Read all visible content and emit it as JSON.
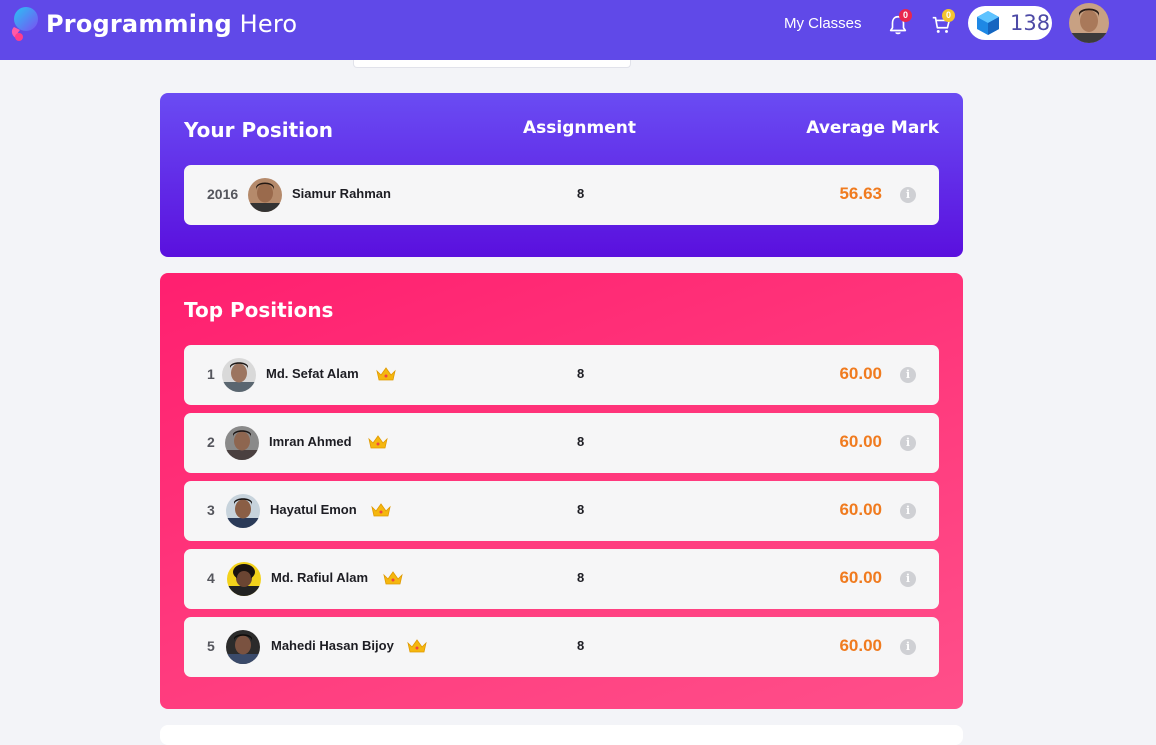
{
  "header": {
    "brand_part1": "Programming",
    "brand_part2": " Hero",
    "nav_my_classes": "My Classes",
    "notifications_count": "0",
    "cart_count": "0",
    "gems": "138"
  },
  "your_position": {
    "title": "Your Position",
    "col_assignment": "Assignment",
    "col_average_mark": "Average Mark",
    "row": {
      "rank": "2016",
      "name": "Siamur Rahman",
      "assignment": "8",
      "mark": "56.63"
    }
  },
  "top_positions": {
    "title": "Top Positions",
    "rows": [
      {
        "rank": "1",
        "name": "Md. Sefat Alam",
        "assignment": "8",
        "mark": "60.00"
      },
      {
        "rank": "2",
        "name": "Imran Ahmed",
        "assignment": "8",
        "mark": "60.00"
      },
      {
        "rank": "3",
        "name": "Hayatul Emon",
        "assignment": "8",
        "mark": "60.00"
      },
      {
        "rank": "4",
        "name": "Md. Rafiul Alam",
        "assignment": "8",
        "mark": "60.00"
      },
      {
        "rank": "5",
        "name": "Mahedi Hasan Bijoy",
        "assignment": "8",
        "mark": "60.00"
      }
    ]
  },
  "icons": {
    "logo": "programming-hero-logo",
    "bell": "bell-icon",
    "cart": "cart-icon",
    "gem": "gem-icon",
    "crown": "crown-icon",
    "info": "info-icon"
  },
  "colors": {
    "header": "#6049e8",
    "your_card": "#5a10de",
    "top_card": "#ff2a74",
    "mark": "#f07b1f"
  }
}
